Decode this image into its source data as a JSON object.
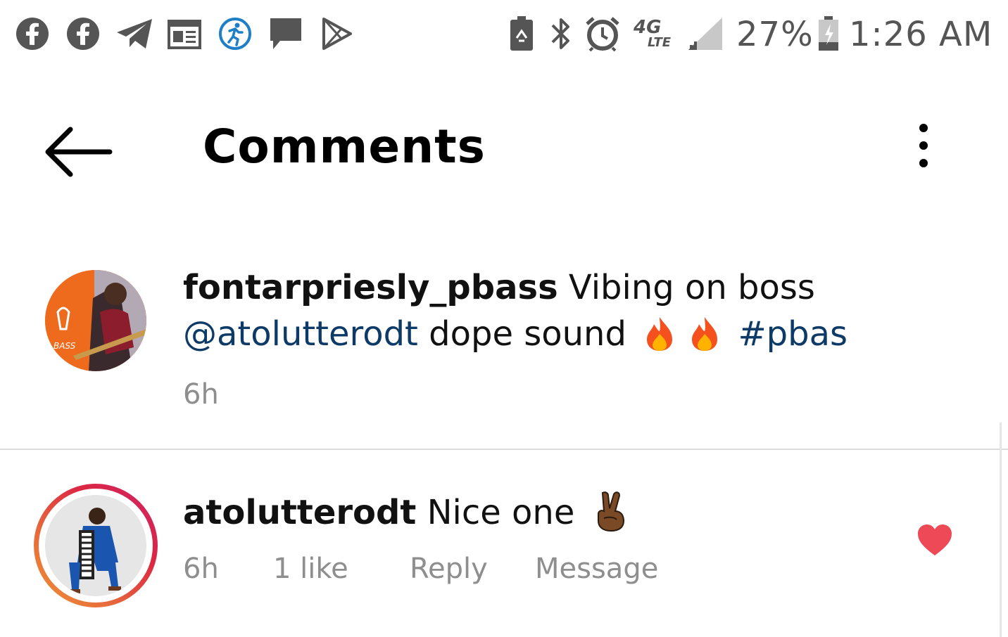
{
  "status_bar": {
    "left_icons": [
      "facebook-icon",
      "facebook-icon",
      "telegram-icon",
      "news-icon",
      "fitness-app-icon",
      "message-icon",
      "play-store-icon"
    ],
    "right_icons": [
      "battery-saver-icon",
      "bluetooth-icon",
      "alarm-icon",
      "4g-lte-icon",
      "signal-icon",
      "battery-icon"
    ],
    "network_label": "4G",
    "network_sub": "LTE",
    "battery_percent": "27%",
    "time": "1:26 AM"
  },
  "header": {
    "back_icon": "arrow-left-icon",
    "title": "Comments",
    "more_icon": "more-vertical-icon"
  },
  "colors": {
    "mention": "#0d3a66",
    "meta_gray": "#8e8e8e",
    "heart": "#ed4956",
    "avatar_ring_start": "#f09433",
    "avatar_ring_end": "#dc2743"
  },
  "comments": [
    {
      "username": "fontarpriesly_pbass",
      "text_1": "Vibing on boss",
      "mention": "@atolutterodt",
      "text_2": "dope sound",
      "emojis": [
        "fire",
        "fire"
      ],
      "hashtag": "#pbas",
      "time": "6h"
    },
    {
      "username": "atolutterodt",
      "text": "Nice one",
      "emoji": "victory-hand",
      "time": "6h",
      "likes": "1 like",
      "reply_label": "Reply",
      "message_label": "Message",
      "liked": true
    }
  ]
}
